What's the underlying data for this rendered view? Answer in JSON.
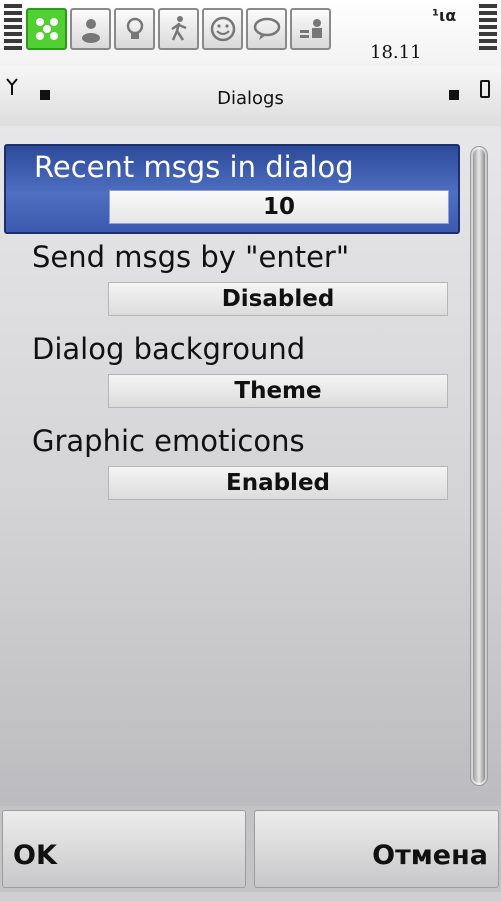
{
  "status": {
    "clock": "18.11",
    "tabs": [
      {
        "icon": "contacts-group-icon",
        "active": true
      },
      {
        "icon": "person-icon",
        "active": false
      },
      {
        "icon": "lightbulb-icon",
        "active": false
      },
      {
        "icon": "walking-person-icon",
        "active": false
      },
      {
        "icon": "smiley-icon",
        "active": false
      },
      {
        "icon": "speech-bubble-icon",
        "active": false
      },
      {
        "icon": "contact-card-icon",
        "active": false
      }
    ],
    "connectivity_indicator": "¹ια"
  },
  "titlebar": {
    "title": "Dialogs"
  },
  "settings": [
    {
      "label": "Recent msgs in dialog",
      "value": "10",
      "selected": true
    },
    {
      "label": "Send msgs by \"enter\"",
      "value": "Disabled",
      "selected": false
    },
    {
      "label": "Dialog background",
      "value": "Theme",
      "selected": false
    },
    {
      "label": "Graphic emoticons",
      "value": "Enabled",
      "selected": false
    }
  ],
  "softkeys": {
    "left": "OK",
    "right": "Отмена"
  },
  "colors": {
    "accent_selection": "#3b5aaf",
    "active_tab": "#52d033"
  }
}
